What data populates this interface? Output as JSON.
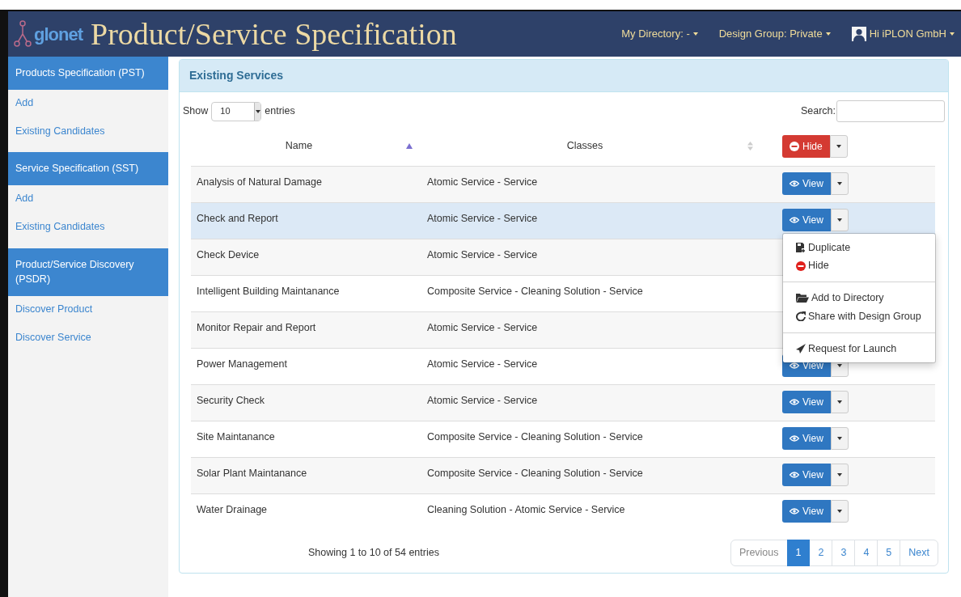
{
  "header": {
    "logo_text": "glonet",
    "title": "Product/Service Specification",
    "menus": [
      {
        "label": "My Directory: -",
        "kind": "menu"
      },
      {
        "label": "Design Group: Private",
        "kind": "menu"
      },
      {
        "label": "Hi iPLON GmbH",
        "kind": "user"
      }
    ]
  },
  "sidebar": [
    {
      "title": "Products Specification (PST)",
      "links": [
        "Add",
        "Existing Candidates"
      ]
    },
    {
      "title": "Service Specification (SST)",
      "links": [
        "Add",
        "Existing Candidates"
      ]
    },
    {
      "title": "Product/Service Discovery (PSDR)",
      "links": [
        "Discover Product",
        "Discover Service"
      ]
    }
  ],
  "panel": {
    "title": "Existing Services",
    "length": {
      "before": "Show",
      "value": "10",
      "after": "entries"
    },
    "search": {
      "label": "Search:"
    },
    "columns": [
      {
        "label": "Name",
        "sorted": true
      },
      {
        "label": "Classes",
        "sorted": false
      }
    ],
    "header_button": {
      "label": "Hide",
      "kind": "danger"
    },
    "rows": [
      {
        "name": "Analysis of Natural Damage",
        "classes": "Atomic Service - Service",
        "button": "View",
        "selected": false
      },
      {
        "name": "Check and Report",
        "classes": "Atomic Service - Service",
        "button": "View",
        "selected": true,
        "menu": [
          [
            {
              "label": "Duplicate",
              "kind": "duplicate"
            },
            {
              "label": "Hide",
              "kind": "hide"
            }
          ],
          [
            {
              "label": "Add to Directory",
              "kind": "folder"
            },
            {
              "label": "Share with Design Group",
              "kind": "share"
            }
          ],
          [
            {
              "label": "Request for Launch",
              "kind": "launch"
            }
          ]
        ]
      },
      {
        "name": "Check Device",
        "classes": "Atomic Service - Service",
        "selected": false
      },
      {
        "name": "Intelligent Building Maintanance",
        "classes": "Composite Service - Cleaning Solution - Service",
        "selected": false
      },
      {
        "name": "Monitor Repair and Report",
        "classes": "Atomic Service - Service",
        "selected": false
      },
      {
        "name": "Power Management",
        "classes": "Atomic Service - Service",
        "button": "View",
        "selected": false
      },
      {
        "name": "Security Check",
        "classes": "Atomic Service - Service",
        "button": "View",
        "selected": false
      },
      {
        "name": "Site Maintanance",
        "classes": "Composite Service - Cleaning Solution - Service",
        "button": "View",
        "selected": false
      },
      {
        "name": "Solar Plant Maintanance",
        "classes": "Composite Service - Cleaning Solution - Service",
        "button": "View",
        "selected": false
      },
      {
        "name": "Water Drainage",
        "classes": "Cleaning Solution - Atomic Service - Service",
        "button": "View",
        "selected": false
      }
    ],
    "info": "Showing 1 to 10 of 54 entries",
    "pagination": {
      "previous": "Previous",
      "pages": [
        {
          "label": "1",
          "selected": true
        },
        {
          "label": "2",
          "selected": false
        },
        {
          "label": "3",
          "selected": false
        },
        {
          "label": "4",
          "selected": false
        },
        {
          "label": "5",
          "selected": false
        }
      ],
      "next": "Next"
    }
  }
}
